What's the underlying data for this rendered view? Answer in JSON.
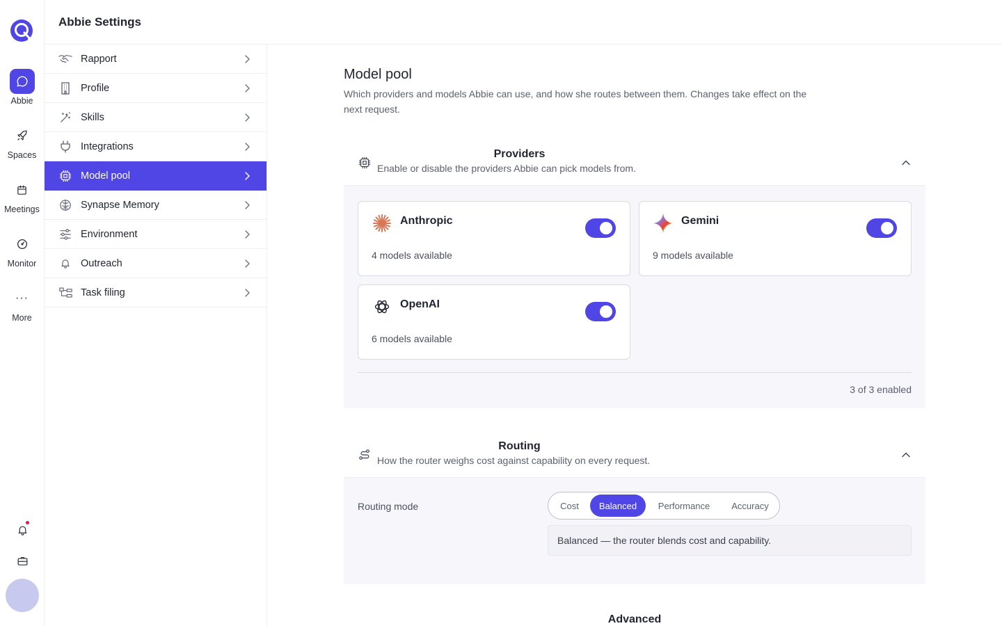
{
  "rail": {
    "items": [
      {
        "label": "Abbie",
        "icon": "chat-bubble-icon",
        "active": true
      },
      {
        "label": "Spaces",
        "icon": "rocket-icon"
      },
      {
        "label": "Meetings",
        "icon": "calendar-icon"
      },
      {
        "label": "Monitor",
        "icon": "gauge-icon"
      },
      {
        "label": "More",
        "icon": "more-dots-icon"
      }
    ],
    "more_glyph": "···"
  },
  "header": {
    "title": "Abbie Settings"
  },
  "nav": {
    "items": [
      {
        "label": "Rapport",
        "icon": "handshake-icon"
      },
      {
        "label": "Profile",
        "icon": "building-icon"
      },
      {
        "label": "Skills",
        "icon": "magic-wand-icon"
      },
      {
        "label": "Integrations",
        "icon": "plug-icon"
      },
      {
        "label": "Model pool",
        "icon": "cpu-chip-icon",
        "active": true
      },
      {
        "label": "Synapse Memory",
        "icon": "brain-icon"
      },
      {
        "label": "Environment",
        "icon": "sliders-icon"
      },
      {
        "label": "Outreach",
        "icon": "bell-icon"
      },
      {
        "label": "Task filing",
        "icon": "hierarchy-icon"
      }
    ]
  },
  "page": {
    "title": "Model pool",
    "description": "Which providers and models Abbie can use, and how she routes between them. Changes take effect on the next request."
  },
  "providers": {
    "title": "Providers",
    "subtitle": "Enable or disable the providers Abbie can pick models from.",
    "cards": [
      {
        "name": "Anthropic",
        "count": "4 models available",
        "enabled": true,
        "icon": "anthropic-logo-icon"
      },
      {
        "name": "Gemini",
        "count": "9 models available",
        "enabled": true,
        "icon": "gemini-logo-icon"
      },
      {
        "name": "OpenAI",
        "count": "6 models available",
        "enabled": true,
        "icon": "openai-logo-icon"
      }
    ],
    "enabled_summary": "3 of 3 enabled"
  },
  "routing": {
    "title": "Routing",
    "subtitle": "How the router weighs cost against capability on every request.",
    "mode_label": "Routing mode",
    "options": [
      "Cost",
      "Balanced",
      "Performance",
      "Accuracy"
    ],
    "selected": "Balanced",
    "mode_description": "Balanced — the router blends cost and capability."
  },
  "advanced": {
    "title": "Advanced"
  },
  "colors": {
    "accent": "#4f46e5",
    "notification": "#e11d48"
  }
}
